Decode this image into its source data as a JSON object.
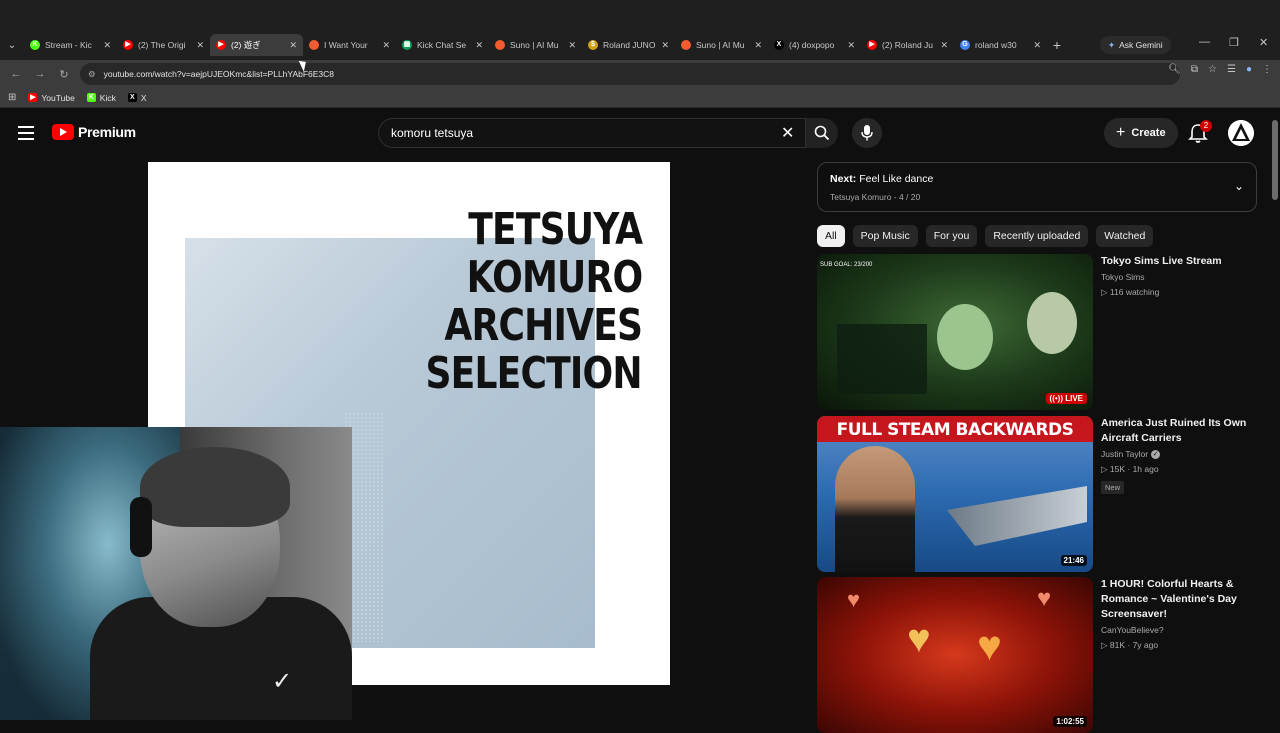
{
  "browser": {
    "tabs": [
      {
        "label": "Stream - Kic",
        "favicon_color": "#53fc18",
        "favicon_glyph": "K"
      },
      {
        "label": "(2) The Origi",
        "favicon_color": "#ff0000",
        "favicon_glyph": "▶"
      },
      {
        "label": "(2) 遊ぎ",
        "favicon_color": "#ff0000",
        "favicon_glyph": "▶",
        "active": true
      },
      {
        "label": "I Want Your",
        "favicon_color": "#f25c2e",
        "favicon_glyph": ""
      },
      {
        "label": "Kick Chat Se",
        "favicon_color": "#0f9d58",
        "favicon_glyph": "▦"
      },
      {
        "label": "Suno | AI Mu",
        "favicon_color": "#f25c2e",
        "favicon_glyph": ""
      },
      {
        "label": "Roland JUNO",
        "favicon_color": "#d4a017",
        "favicon_glyph": "$"
      },
      {
        "label": "Suno | AI Mu",
        "favicon_color": "#f25c2e",
        "favicon_glyph": ""
      },
      {
        "label": "(4) doxpopo",
        "favicon_color": "#000000",
        "favicon_glyph": "X"
      },
      {
        "label": "(2) Roland Ju",
        "favicon_color": "#ff0000",
        "favicon_glyph": "▶"
      },
      {
        "label": "roland w30",
        "favicon_color": "#4285f4",
        "favicon_glyph": "G"
      }
    ],
    "ask_gemini": "Ask Gemini",
    "url": "youtube.com/watch?v=aejpUJEOKmc&list=PLLhYAbF6E3C8",
    "bookmarks": [
      {
        "label": "YouTube",
        "color": "#ff0000",
        "glyph": "▶"
      },
      {
        "label": "Kick",
        "color": "#53fc18",
        "glyph": "K"
      },
      {
        "label": "X",
        "color": "#000000",
        "glyph": "X"
      }
    ]
  },
  "youtube": {
    "logo_text": "Premium",
    "search_query": "komoru tetsuya",
    "create_label": "Create",
    "notification_count": "2"
  },
  "player": {
    "title_lines": [
      "TETSUYA",
      "KOMURO",
      "ARCHIVES",
      "SELECTION"
    ]
  },
  "playlist": {
    "next_label": "Next:",
    "next_title": "Feel Like dance",
    "subtitle": "Tetsuya Komuro - 4 / 20"
  },
  "chips": [
    "All",
    "Pop Music",
    "For you",
    "Recently uploaded",
    "Watched"
  ],
  "recommendations": [
    {
      "title": "Tokyo Sims Live Stream",
      "channel": "Tokyo Sims",
      "stats": "116 watching",
      "badge": "LIVE",
      "thumb_note": "SUB GOAL: 23/200",
      "verified": false
    },
    {
      "title": "America Just Ruined Its Own Aircraft Carriers",
      "channel": "Justin Taylor",
      "stats": "15K · 1h ago",
      "badge": "21:46",
      "thumb_note": "FULL STEAM BACKWARDS",
      "new": "New",
      "verified": true
    },
    {
      "title": "1 HOUR!  Colorful Hearts & Romance ~ Valentine's Day Screensaver!",
      "channel": "CanYouBelieve?",
      "stats": "81K · 7y ago",
      "badge": "1:02:55",
      "verified": false
    }
  ]
}
